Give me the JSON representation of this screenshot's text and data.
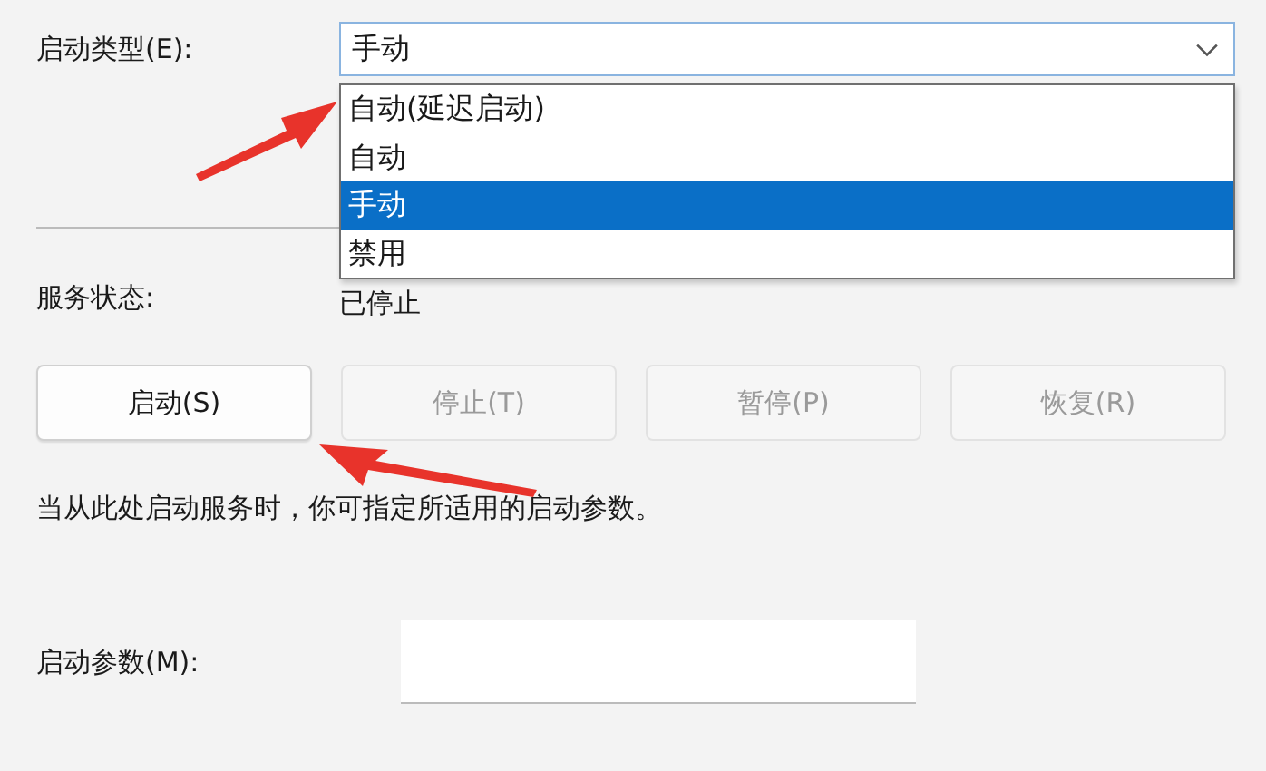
{
  "startup_type": {
    "label": "启动类型(E):",
    "value": "手动",
    "expanded": true,
    "options": [
      {
        "label": "自动(延迟启动)",
        "selected": false
      },
      {
        "label": "自动",
        "selected": false
      },
      {
        "label": "手动",
        "selected": true
      },
      {
        "label": "禁用",
        "selected": false
      }
    ]
  },
  "service_status": {
    "label": "服务状态:",
    "value": "已停止"
  },
  "buttons": [
    {
      "label": "启动(S)",
      "disabled": false
    },
    {
      "label": "停止(T)",
      "disabled": true
    },
    {
      "label": "暂停(P)",
      "disabled": true
    },
    {
      "label": "恢复(R)",
      "disabled": true
    }
  ],
  "hint": "当从此处启动服务时，你可指定所适用的启动参数。",
  "start_parameters": {
    "label": "启动参数(M):"
  }
}
